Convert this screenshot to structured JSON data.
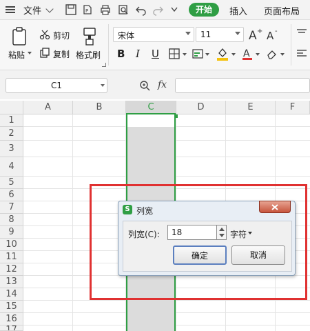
{
  "menubar": {
    "file_label": "文件",
    "tab_start": "开始",
    "tab_insert": "插入",
    "tab_page_layout": "页面布局"
  },
  "ribbon": {
    "paste_label": "粘贴",
    "cut_label": "剪切",
    "copy_label": "复制",
    "format_painter_label": "格式刷",
    "font_name": "宋体",
    "font_size": "11",
    "bold": "B",
    "italic": "I",
    "underline": "U"
  },
  "formula_bar": {
    "name_box": "C1",
    "fx_label": "fx",
    "formula_value": ""
  },
  "grid": {
    "columns": [
      "A",
      "B",
      "C",
      "D",
      "E",
      "F"
    ],
    "rows": [
      "1",
      "2",
      "3",
      "4",
      "5",
      "6",
      "7",
      "8",
      "9",
      "10",
      "11",
      "12",
      "13",
      "14",
      "15",
      "16",
      "17"
    ]
  },
  "dialog": {
    "title": "列宽",
    "field_label": "列宽(C):",
    "field_value": "18",
    "unit": "字符",
    "ok": "确定",
    "cancel": "取消"
  },
  "colors": {
    "accent_green": "#2f9e44",
    "highlight_red": "#e03131",
    "selection_green": "#2f9e44"
  }
}
